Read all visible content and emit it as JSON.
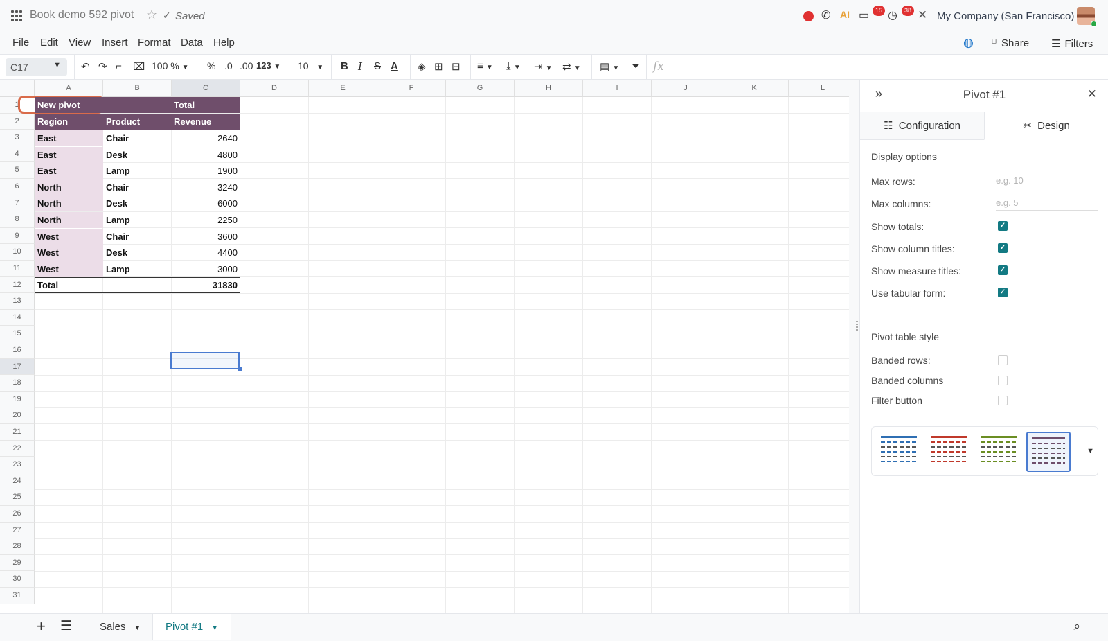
{
  "topbar": {
    "doc_title": "Book demo 592 pivot",
    "saved_label": "Saved",
    "chat_badge": "15",
    "activity_badge": "38",
    "company": "My Company (San Francisco)"
  },
  "menubar": {
    "items": [
      "File",
      "Edit",
      "View",
      "Insert",
      "Format",
      "Data",
      "Help"
    ],
    "share_label": "Share",
    "filters_label": "Filters"
  },
  "toolbar": {
    "cell_ref": "C17",
    "zoom": "100 %",
    "percent": "%",
    "dec_less": ".0",
    "dec_more": ".00",
    "number_format": "123",
    "font_size": "10",
    "fx": "fx"
  },
  "grid": {
    "columns": [
      "A",
      "B",
      "C",
      "D",
      "E",
      "F",
      "G",
      "H",
      "I",
      "J",
      "K",
      "L"
    ],
    "rows": [
      "1",
      "2",
      "3",
      "4",
      "5",
      "6",
      "7",
      "8",
      "9",
      "10",
      "11",
      "12",
      "13",
      "14",
      "15",
      "16",
      "17",
      "18",
      "19",
      "20",
      "21",
      "22",
      "23",
      "24",
      "25",
      "26",
      "27",
      "28",
      "29",
      "30",
      "31"
    ],
    "pivot": {
      "title": "New pivot",
      "measure_header": "Total",
      "col_region": "Region",
      "col_product": "Product",
      "col_revenue": "Revenue",
      "rows": [
        {
          "region": "East",
          "product": "Chair",
          "revenue": "2640"
        },
        {
          "region": "East",
          "product": "Desk",
          "revenue": "4800"
        },
        {
          "region": "East",
          "product": "Lamp",
          "revenue": "1900"
        },
        {
          "region": "North",
          "product": "Chair",
          "revenue": "3240"
        },
        {
          "region": "North",
          "product": "Desk",
          "revenue": "6000"
        },
        {
          "region": "North",
          "product": "Lamp",
          "revenue": "2250"
        },
        {
          "region": "West",
          "product": "Chair",
          "revenue": "3600"
        },
        {
          "region": "West",
          "product": "Desk",
          "revenue": "4400"
        },
        {
          "region": "West",
          "product": "Lamp",
          "revenue": "3000"
        }
      ],
      "total_label": "Total",
      "total_value": "31830"
    }
  },
  "panel": {
    "title": "Pivot #1",
    "tab_configuration": "Configuration",
    "tab_design": "Design",
    "display_options": "Display options",
    "max_rows_label": "Max rows:",
    "max_rows_placeholder": "e.g. 10",
    "max_columns_label": "Max columns:",
    "max_columns_placeholder": "e.g. 5",
    "show_totals": "Show totals:",
    "show_column_titles": "Show column titles:",
    "show_measure_titles": "Show measure titles:",
    "use_tabular_form": "Use tabular form:",
    "pivot_table_style": "Pivot table style",
    "banded_rows": "Banded rows:",
    "banded_columns": "Banded columns",
    "filter_button": "Filter button",
    "style_colors": [
      "#2f6fb3",
      "#c0392b",
      "#6b8e23",
      "#6f4e6b"
    ]
  },
  "sheets": {
    "tabs": [
      "Sales",
      "Pivot #1"
    ]
  }
}
